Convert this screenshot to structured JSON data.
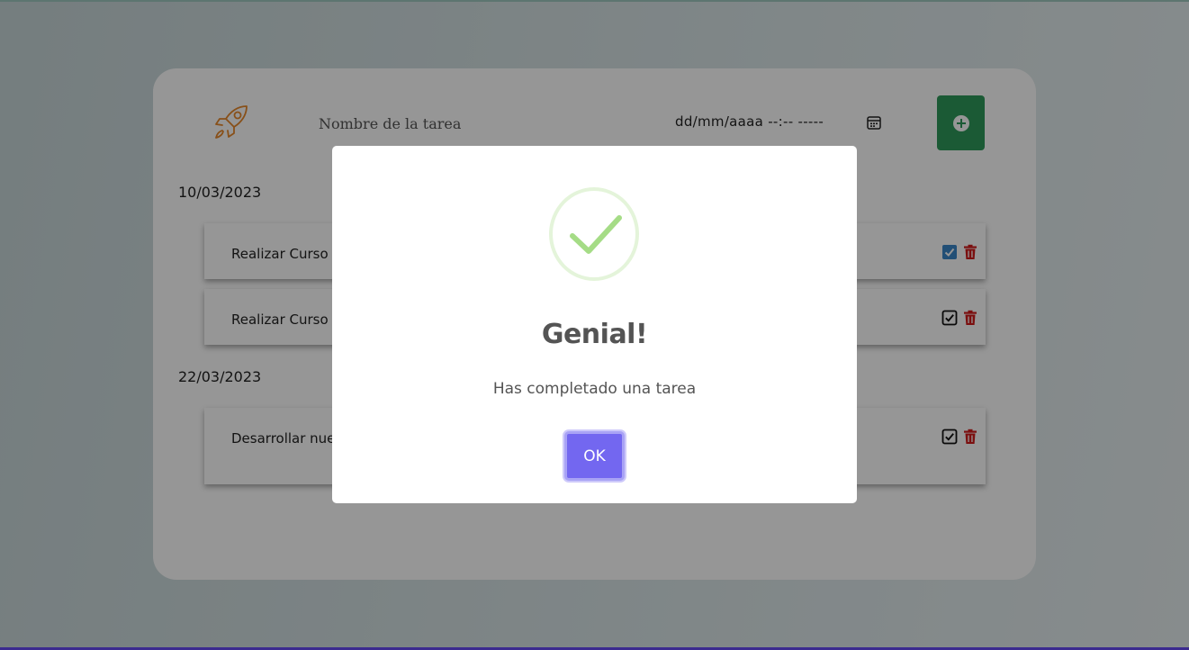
{
  "form": {
    "task_placeholder": "Nombre de la tarea",
    "date_placeholder": "dd/mm/aaaa --:-- -----"
  },
  "groups": [
    {
      "date": "10/03/2023",
      "tasks": [
        {
          "text": "Realizar Curso d",
          "completed": true
        },
        {
          "text": "Realizar Curso d",
          "completed": false
        }
      ]
    },
    {
      "date": "22/03/2023",
      "tasks": [
        {
          "text": "Desarrollar nuev… que puedan llegar …emas cosas",
          "completed": false
        }
      ]
    }
  ],
  "modal": {
    "title": "Genial!",
    "message": "Has completado una tarea",
    "ok_label": "OK"
  },
  "colors": {
    "add_button": "#2f9a5a",
    "ok_button": "#7367f0",
    "checkbox_checked": "#3b86c9",
    "delete": "#d11b1b",
    "success": "#a5dc86",
    "rocket": "#e8892c"
  }
}
